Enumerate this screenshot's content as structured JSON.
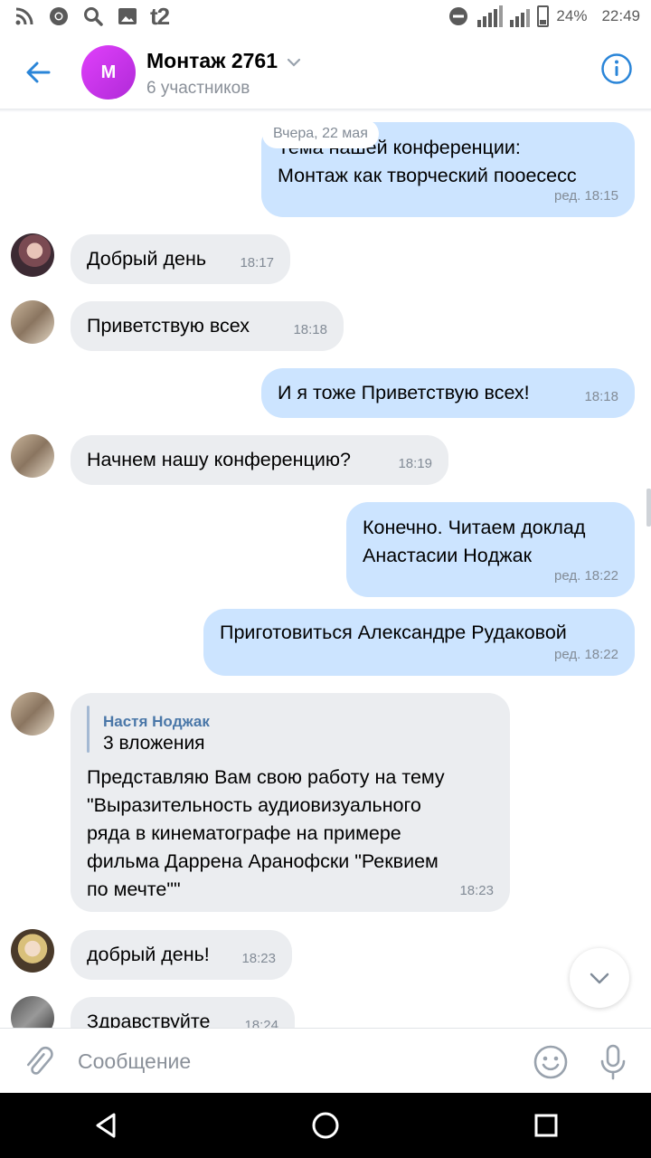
{
  "status_bar": {
    "carrier": "t2",
    "battery": "24%",
    "time": "22:49"
  },
  "header": {
    "avatar_letter": "M",
    "title": "Монтаж 2761",
    "subtitle": "6 участников"
  },
  "chat": {
    "date_separator": "Вчера, 22 мая",
    "messages": [
      {
        "side": "out",
        "text": "Тема нашей конференции:\nМонтаж как творческий пооесесс",
        "meta": "ред. 18:15"
      },
      {
        "side": "in",
        "text": "Добрый день",
        "meta": "18:17"
      },
      {
        "side": "in",
        "text": "Приветствую всех",
        "meta": "18:18"
      },
      {
        "side": "out",
        "text": "И я тоже Приветствую всех!",
        "meta": "18:18"
      },
      {
        "side": "in",
        "text": "Начнем нашу конференцию?",
        "meta": "18:19"
      },
      {
        "side": "out",
        "text": "Конечно. Читаем доклад\nАнастасии Нoджак",
        "meta": "ред. 18:22"
      },
      {
        "side": "out",
        "text": "Приготовиться Александре Рудаковой",
        "meta": "ред. 18:22"
      },
      {
        "side": "in",
        "reply_name": "Настя Нoджак",
        "reply_sub": "3 вложения",
        "text": "Представляю Вам свою работу на тему\n\"Выразительность аудиовизуального\nряда в кинематографе на примере\nфильма Даррена Аранофски \"Реквием\nпо мечте\"\"",
        "meta": "18:23"
      },
      {
        "side": "in",
        "text": "добрый день!",
        "meta": "18:23"
      },
      {
        "side": "in",
        "text": "Здравствуйте",
        "meta": "18:24"
      }
    ]
  },
  "composer": {
    "placeholder": "Сообщение"
  },
  "icons": {
    "accent": "#2a85d8",
    "avatar_gradient": [
      "#e040fb",
      "#b02ad8"
    ]
  }
}
